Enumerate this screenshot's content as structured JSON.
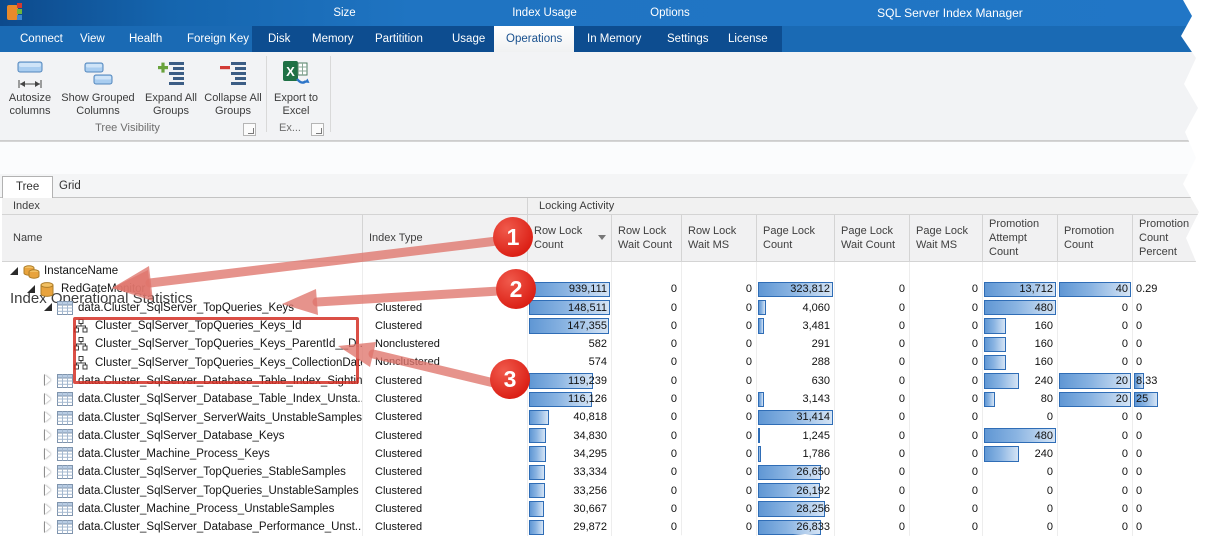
{
  "window": {
    "title": "SQL Server Index Manager"
  },
  "ribbon_tabs": {
    "plain": [
      "Connect",
      "View",
      "Health",
      "Foreign Key"
    ],
    "groups": [
      {
        "caption": "Size",
        "items": [
          "Disk",
          "Memory",
          "Partitition"
        ]
      },
      {
        "caption": "Index Usage",
        "items": [
          "Usage",
          "Operations",
          "In Memory"
        ]
      },
      {
        "caption": "Options",
        "items": [
          "Settings",
          "License"
        ]
      }
    ],
    "active": "Operations"
  },
  "ribbon": {
    "buttons": [
      {
        "label": "Autosize columns",
        "icon": "autosize-columns-icon"
      },
      {
        "label": "Show Grouped Columns",
        "icon": "show-grouped-columns-icon"
      },
      {
        "label": "Expand All Groups",
        "icon": "expand-all-groups-icon"
      },
      {
        "label": "Collapse All Groups",
        "icon": "collapse-all-groups-icon"
      },
      {
        "label": "Export to Excel",
        "icon": "export-to-excel-icon"
      }
    ],
    "group_captions": [
      "Tree Visibility",
      "Ex..."
    ]
  },
  "page": {
    "heading": "Index Operational Statistics",
    "view_tabs": [
      "Tree",
      "Grid"
    ],
    "active_view": "Tree"
  },
  "grid": {
    "band_headers": [
      "Index",
      "Locking Activity"
    ],
    "columns": [
      "Name",
      "Index Type",
      "Row Lock Count",
      "Row Lock Wait Count",
      "Row Lock Wait MS",
      "Page Lock Count",
      "Page Lock Wait Count",
      "Page Lock Wait MS",
      "Promotion Attempt Count",
      "Promotion Count",
      "Promotion Count Percent"
    ],
    "sort": {
      "column": "Row Lock Count",
      "direction": "desc"
    },
    "colors": {
      "bar_fill": "#6097d4",
      "bar_border": "#2f6db6"
    },
    "rows": [
      {
        "name": "InstanceName",
        "level": 0,
        "icon": "server-icon",
        "caret": "expanded",
        "index_type": "",
        "cells": [
          {
            "v": ""
          },
          {
            "v": ""
          },
          {
            "v": ""
          },
          {
            "v": ""
          },
          {
            "v": ""
          },
          {
            "v": ""
          },
          {
            "v": ""
          },
          {
            "v": ""
          },
          {
            "v": ""
          }
        ]
      },
      {
        "name": "RedGateMonitor",
        "level": 1,
        "icon": "database-icon",
        "caret": "expanded",
        "index_type": "",
        "cells": [
          {
            "v": "939,111",
            "bar": 100
          },
          {
            "v": "0"
          },
          {
            "v": "0"
          },
          {
            "v": "323,812",
            "bar": 100
          },
          {
            "v": "0"
          },
          {
            "v": "0"
          },
          {
            "v": "13,712",
            "bar": 100
          },
          {
            "v": "40",
            "bar": 100
          },
          {
            "v": "0.29"
          }
        ]
      },
      {
        "name": "data.Cluster_SqlServer_TopQueries_Keys",
        "level": 2,
        "icon": "table-icon",
        "caret": "expanded",
        "index_type": "Clustered",
        "cells": [
          {
            "v": "148,511",
            "bar": 100
          },
          {
            "v": "0"
          },
          {
            "v": "0"
          },
          {
            "v": "4,060",
            "bar": 13
          },
          {
            "v": "0"
          },
          {
            "v": "0"
          },
          {
            "v": "480",
            "bar": 100
          },
          {
            "v": "0"
          },
          {
            "v": "0"
          }
        ]
      },
      {
        "name": "Cluster_SqlServer_TopQueries_Keys_Id",
        "level": 3,
        "icon": "index-icon",
        "caret": "none",
        "index_type": "Clustered",
        "cells": [
          {
            "v": "147,355",
            "bar": 99
          },
          {
            "v": "0"
          },
          {
            "v": "0"
          },
          {
            "v": "3,481",
            "bar": 11
          },
          {
            "v": "0"
          },
          {
            "v": "0"
          },
          {
            "v": "160",
            "bar": 33
          },
          {
            "v": "0"
          },
          {
            "v": "0"
          }
        ]
      },
      {
        "name": "Cluster_SqlServer_TopQueries_Keys_ParentId__D...",
        "level": 3,
        "icon": "index-icon",
        "caret": "none",
        "index_type": "Nonclustered",
        "cells": [
          {
            "v": "582"
          },
          {
            "v": "0"
          },
          {
            "v": "0"
          },
          {
            "v": "291"
          },
          {
            "v": "0"
          },
          {
            "v": "0"
          },
          {
            "v": "160",
            "bar": 33
          },
          {
            "v": "0"
          },
          {
            "v": "0"
          }
        ]
      },
      {
        "name": "Cluster_SqlServer_TopQueries_Keys_CollectionDate",
        "level": 3,
        "icon": "index-icon",
        "caret": "none",
        "index_type": "Nonclustered",
        "cells": [
          {
            "v": "574"
          },
          {
            "v": "0"
          },
          {
            "v": "0"
          },
          {
            "v": "288"
          },
          {
            "v": "0"
          },
          {
            "v": "0"
          },
          {
            "v": "160",
            "bar": 33
          },
          {
            "v": "0"
          },
          {
            "v": "0"
          }
        ]
      },
      {
        "name": "data.Cluster_SqlServer_Database_Table_Index_Sightings",
        "level": 2,
        "icon": "table-icon",
        "caret": "collapsed",
        "index_type": "Clustered",
        "cells": [
          {
            "v": "119,239",
            "bar": 80
          },
          {
            "v": "0"
          },
          {
            "v": "0"
          },
          {
            "v": "630"
          },
          {
            "v": "0"
          },
          {
            "v": "0"
          },
          {
            "v": "240",
            "bar": 50
          },
          {
            "v": "20",
            "bar": 100
          },
          {
            "v": "8.33",
            "bar": 16
          }
        ]
      },
      {
        "name": "data.Cluster_SqlServer_Database_Table_Index_Unsta...",
        "level": 2,
        "icon": "table-icon",
        "caret": "collapsed",
        "index_type": "Clustered",
        "cells": [
          {
            "v": "116,126",
            "bar": 78
          },
          {
            "v": "0"
          },
          {
            "v": "0"
          },
          {
            "v": "3,143",
            "bar": 10
          },
          {
            "v": "0"
          },
          {
            "v": "0"
          },
          {
            "v": "80",
            "bar": 17
          },
          {
            "v": "20",
            "bar": 100
          },
          {
            "v": "25",
            "bar": 34
          }
        ]
      },
      {
        "name": "data.Cluster_SqlServer_ServerWaits_UnstableSamples",
        "level": 2,
        "icon": "table-icon",
        "caret": "collapsed",
        "index_type": "Clustered",
        "cells": [
          {
            "v": "40,818",
            "bar": 27
          },
          {
            "v": "0"
          },
          {
            "v": "0"
          },
          {
            "v": "31,414",
            "bar": 100
          },
          {
            "v": "0"
          },
          {
            "v": "0"
          },
          {
            "v": "0"
          },
          {
            "v": "0"
          },
          {
            "v": "0"
          }
        ]
      },
      {
        "name": "data.Cluster_SqlServer_Database_Keys",
        "level": 2,
        "icon": "table-icon",
        "caret": "collapsed",
        "index_type": "Clustered",
        "cells": [
          {
            "v": "34,830",
            "bar": 23
          },
          {
            "v": "0"
          },
          {
            "v": "0"
          },
          {
            "v": "1,245",
            "bar": 4
          },
          {
            "v": "0"
          },
          {
            "v": "0"
          },
          {
            "v": "480",
            "bar": 100
          },
          {
            "v": "0"
          },
          {
            "v": "0"
          }
        ]
      },
      {
        "name": "data.Cluster_Machine_Process_Keys",
        "level": 2,
        "icon": "table-icon",
        "caret": "collapsed",
        "index_type": "Clustered",
        "cells": [
          {
            "v": "34,295",
            "bar": 23
          },
          {
            "v": "0"
          },
          {
            "v": "0"
          },
          {
            "v": "1,786",
            "bar": 6
          },
          {
            "v": "0"
          },
          {
            "v": "0"
          },
          {
            "v": "240",
            "bar": 50
          },
          {
            "v": "0"
          },
          {
            "v": "0"
          }
        ]
      },
      {
        "name": "data.Cluster_SqlServer_TopQueries_StableSamples",
        "level": 2,
        "icon": "table-icon",
        "caret": "collapsed",
        "index_type": "Clustered",
        "cells": [
          {
            "v": "33,334",
            "bar": 22
          },
          {
            "v": "0"
          },
          {
            "v": "0"
          },
          {
            "v": "26,650",
            "bar": 85
          },
          {
            "v": "0"
          },
          {
            "v": "0"
          },
          {
            "v": "0"
          },
          {
            "v": "0"
          },
          {
            "v": "0"
          }
        ]
      },
      {
        "name": "data.Cluster_SqlServer_TopQueries_UnstableSamples",
        "level": 2,
        "icon": "table-icon",
        "caret": "collapsed",
        "index_type": "Clustered",
        "cells": [
          {
            "v": "33,256",
            "bar": 22
          },
          {
            "v": "0"
          },
          {
            "v": "0"
          },
          {
            "v": "26,192",
            "bar": 83
          },
          {
            "v": "0"
          },
          {
            "v": "0"
          },
          {
            "v": "0"
          },
          {
            "v": "0"
          },
          {
            "v": "0"
          }
        ]
      },
      {
        "name": "data.Cluster_Machine_Process_UnstableSamples",
        "level": 2,
        "icon": "table-icon",
        "caret": "collapsed",
        "index_type": "Clustered",
        "cells": [
          {
            "v": "30,667",
            "bar": 21
          },
          {
            "v": "0"
          },
          {
            "v": "0"
          },
          {
            "v": "28,256",
            "bar": 90
          },
          {
            "v": "0"
          },
          {
            "v": "0"
          },
          {
            "v": "0"
          },
          {
            "v": "0"
          },
          {
            "v": "0"
          }
        ]
      },
      {
        "name": "data.Cluster_SqlServer_Database_Performance_Unst...",
        "level": 2,
        "icon": "table-icon",
        "caret": "collapsed",
        "index_type": "Clustered",
        "cells": [
          {
            "v": "29,872",
            "bar": 20
          },
          {
            "v": "0"
          },
          {
            "v": "0"
          },
          {
            "v": "26,833",
            "bar": 85
          },
          {
            "v": "0"
          },
          {
            "v": "0"
          },
          {
            "v": "0"
          },
          {
            "v": "0"
          },
          {
            "v": "0"
          }
        ]
      }
    ]
  },
  "annotations": {
    "color": "#e02b20",
    "callouts": [
      {
        "label": "1"
      },
      {
        "label": "2"
      },
      {
        "label": "3"
      }
    ]
  }
}
